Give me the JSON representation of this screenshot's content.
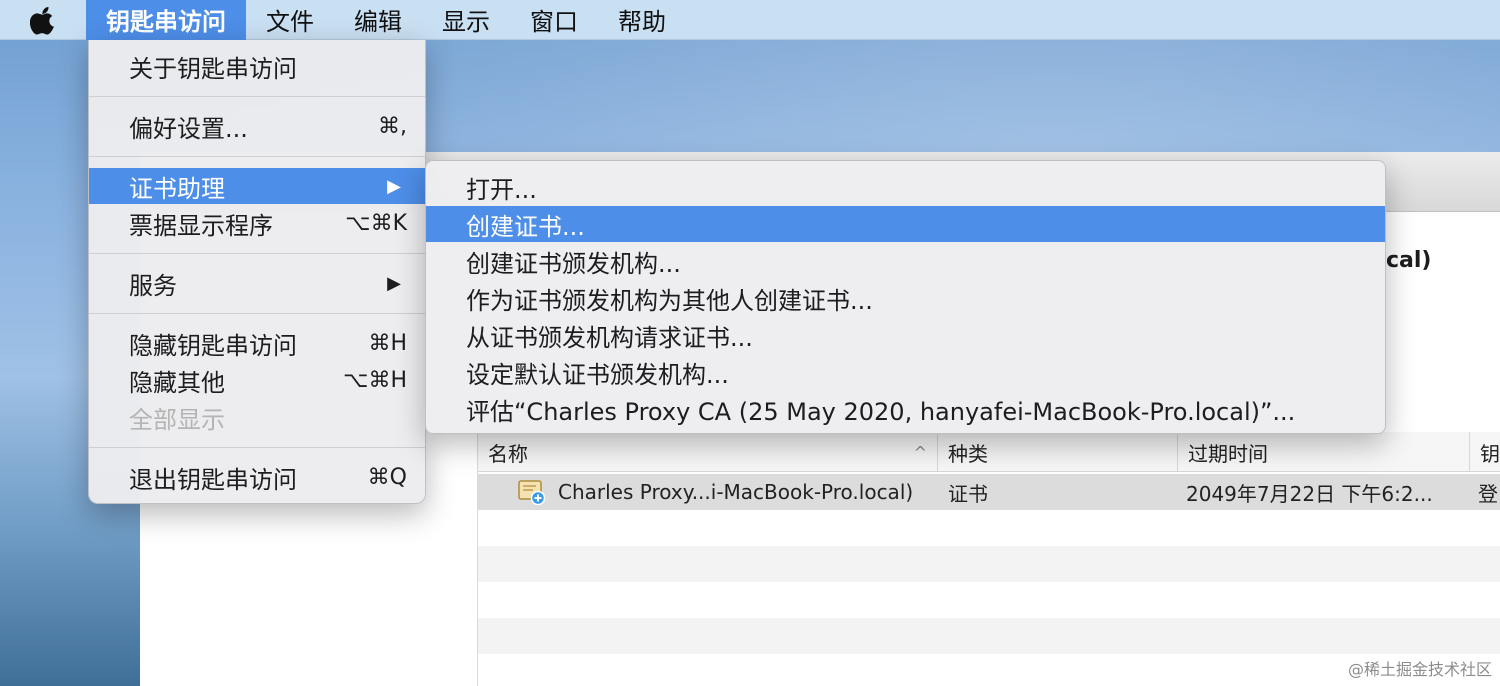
{
  "menubar": {
    "app_menu": "钥匙串访问",
    "items": [
      "文件",
      "编辑",
      "显示",
      "窗口",
      "帮助"
    ]
  },
  "app_menu": {
    "about": "关于钥匙串访问",
    "preferences": {
      "label": "偏好设置...",
      "shortcut": "⌘,"
    },
    "certificate_assistant": "证书助理",
    "ticket_viewer": {
      "label": "票据显示程序",
      "shortcut": "⌥⌘K"
    },
    "services": "服务",
    "hide": {
      "label": "隐藏钥匙串访问",
      "shortcut": "⌘H"
    },
    "hide_others": {
      "label": "隐藏其他",
      "shortcut": "⌥⌘H"
    },
    "show_all": "全部显示",
    "quit": {
      "label": "退出钥匙串访问",
      "shortcut": "⌘Q"
    },
    "submenu_arrow": "▶"
  },
  "submenu": {
    "items": [
      "打开...",
      "创建证书...",
      "创建证书颁发机构...",
      "作为证书颁发机构为其他人创建证书...",
      "从证书颁发机构请求证书...",
      "设定默认证书颁发机构...",
      "评估“Charles Proxy CA (25 May 2020, hanyafei-MacBook-Pro.local)”..."
    ],
    "highlighted_index": 1
  },
  "window": {
    "title_fragment": "cal)",
    "table": {
      "columns": [
        "名称",
        "种类",
        "过期时间",
        "钥"
      ],
      "sort_indicator": "^",
      "rows": [
        {
          "name": "Charles Proxy...i-MacBook-Pro.local)",
          "kind": "证书",
          "expires": "2049年7月22日 下午6:2...",
          "keychain": "登"
        }
      ]
    }
  },
  "watermark": "@稀土掘金技术社区",
  "colors": {
    "highlight": "#4d8ee8",
    "menubar": "#c9dff2"
  }
}
